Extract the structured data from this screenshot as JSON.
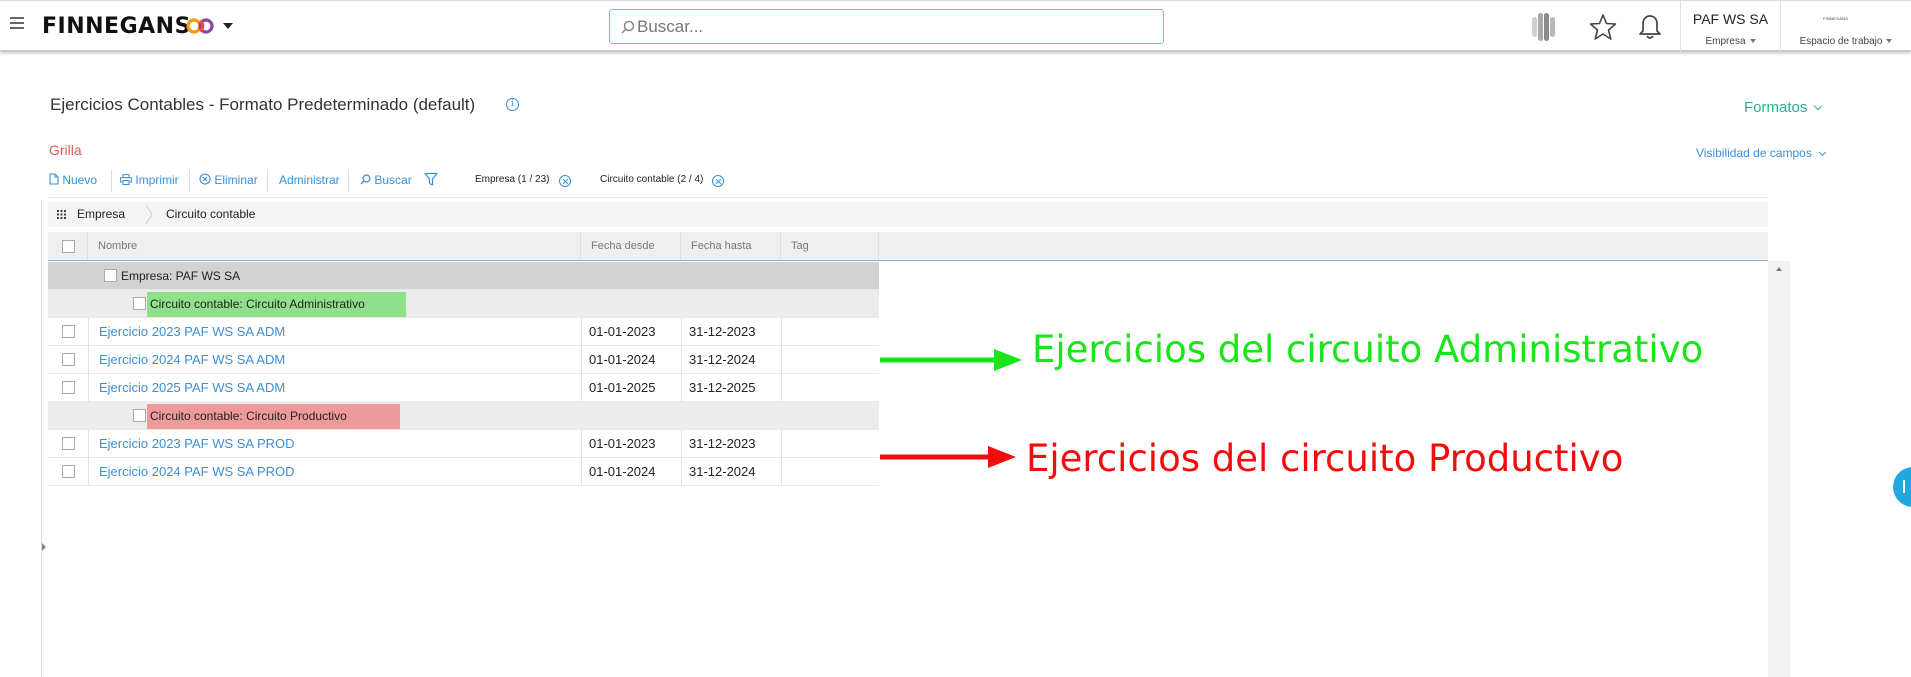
{
  "topbar": {
    "brand": "FINNEGANS",
    "brand_suffix": "CO",
    "search_placeholder": "Buscar...",
    "company_name": "PAF WS SA",
    "company_label": "Empresa",
    "workspace_logo_text": "FINNEGANS",
    "workspace_label": "Espacio de trabajo"
  },
  "page": {
    "title": "Ejercicios Contables - Formato Predeterminado (default)",
    "info_icon": "i",
    "formats_label": "Formatos",
    "view_label": "Grilla",
    "visibility_label": "Visibilidad de campos"
  },
  "toolbar": {
    "new_label": "Nuevo",
    "print_label": "Imprimir",
    "delete_label": "Eliminar",
    "manage_label": "Administrar",
    "search_label": "Buscar",
    "filters": [
      {
        "label": "Empresa (1 / 23)"
      },
      {
        "label": "Circuito contable (2 / 4)"
      }
    ]
  },
  "grouping": {
    "levels": [
      "Empresa",
      "Circuito contable"
    ]
  },
  "table": {
    "columns": [
      "Nombre",
      "Fecha desde",
      "Fecha hasta",
      "Tag"
    ],
    "group_company": "Empresa: PAF WS SA",
    "group_adm": "Circuito contable: Circuito Administrativo",
    "group_prod": "Circuito contable: Circuito Productivo",
    "rows_adm": [
      {
        "name": "Ejercicio 2023 PAF WS SA ADM",
        "from": "01-01-2023",
        "to": "31-12-2023",
        "tag": ""
      },
      {
        "name": "Ejercicio 2024 PAF WS SA ADM",
        "from": "01-01-2024",
        "to": "31-12-2024",
        "tag": ""
      },
      {
        "name": "Ejercicio 2025 PAF WS SA ADM",
        "from": "01-01-2025",
        "to": "31-12-2025",
        "tag": ""
      }
    ],
    "rows_prod": [
      {
        "name": "Ejercicio 2023 PAF WS SA PROD",
        "from": "01-01-2023",
        "to": "31-12-2023",
        "tag": ""
      },
      {
        "name": "Ejercicio 2024 PAF WS SA PROD",
        "from": "01-01-2024",
        "to": "31-12-2024",
        "tag": ""
      }
    ]
  },
  "annotations": {
    "adm": "Ejercicios del circuito Administrativo",
    "prod": "Ejercicios del circuito Productivo",
    "adm_color": "#19e619",
    "prod_color": "#f20d0d"
  },
  "colors": {
    "accent_blue": "#3a8fd6",
    "accent_teal": "#2bae8f",
    "grilla_red": "#e05757",
    "highlight_green": "#8fe08a",
    "highlight_red": "#ee9a9a"
  }
}
